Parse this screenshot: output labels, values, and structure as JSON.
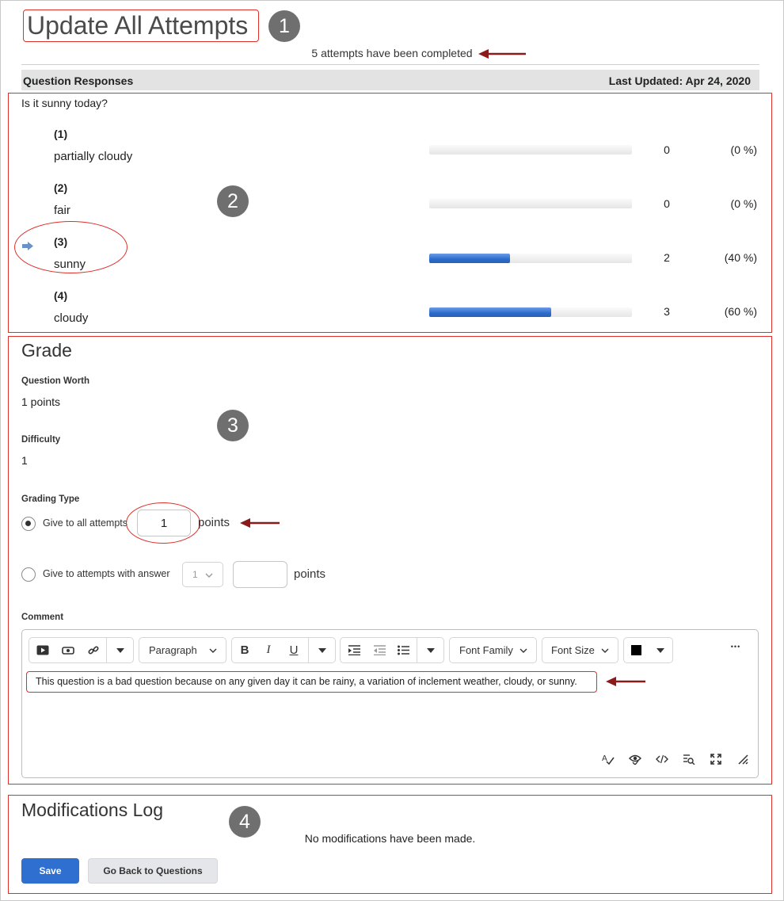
{
  "header": {
    "title": "Update All Attempts",
    "attempts_completed": "5 attempts have been completed"
  },
  "markers": [
    "1",
    "2",
    "3",
    "4"
  ],
  "responses": {
    "heading": "Question Responses",
    "last_updated": "Last Updated: Apr 24, 2020",
    "question": "Is it sunny today?",
    "options": [
      {
        "num": "(1)",
        "text": "partially cloudy",
        "count": "0",
        "percent": "(0 %)",
        "fraction": 0.0
      },
      {
        "num": "(2)",
        "text": "fair",
        "count": "0",
        "percent": "(0 %)",
        "fraction": 0.0
      },
      {
        "num": "(3)",
        "text": "sunny",
        "count": "2",
        "percent": "(40 %)",
        "fraction": 0.4,
        "correct": true
      },
      {
        "num": "(4)",
        "text": "cloudy",
        "count": "3",
        "percent": "(60 %)",
        "fraction": 0.6
      }
    ],
    "bar_color": "#2c6bcc"
  },
  "grade": {
    "title": "Grade",
    "worth_label": "Question Worth",
    "worth_value": "1 points",
    "difficulty_label": "Difficulty",
    "difficulty_value": "1",
    "grading_type_label": "Grading Type",
    "option_all": "Give to all attempts",
    "option_all_value": "1",
    "points_label": "points",
    "option_answer": "Give to attempts with answer",
    "answer_select_value": "1",
    "comment_label": "Comment"
  },
  "editor": {
    "paragraph": "Paragraph",
    "font_family": "Font Family",
    "font_size": "Font Size",
    "bold": "B",
    "italic": "I",
    "underline": "U",
    "more": "•••",
    "comment_text": "This question is a bad question because on any given day it can be rainy, a variation of inclement weather, cloudy, or sunny."
  },
  "modifications": {
    "title": "Modifications Log",
    "empty_text": "No modifications have been made."
  },
  "buttons": {
    "save": "Save",
    "back": "Go Back to Questions"
  },
  "colors": {
    "annotation_red": "#e0302a",
    "arrow_dark_red": "#8b1a1a",
    "primary_blue": "#2e6fd0"
  }
}
